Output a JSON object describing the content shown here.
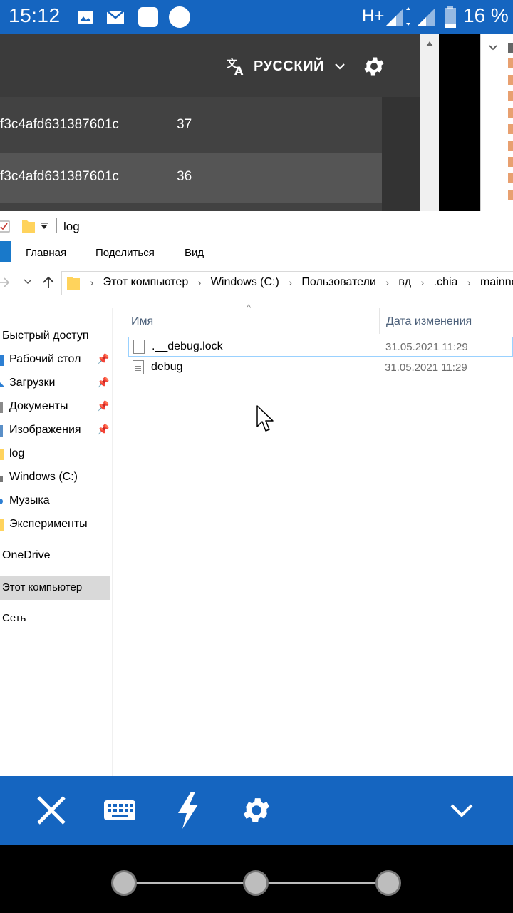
{
  "status_bar": {
    "time": "15:12",
    "network": "H+",
    "battery": "16 %",
    "icons": [
      "image-icon",
      "mail-icon",
      "square-icon",
      "circle-icon",
      "signal-icon",
      "battery-icon"
    ]
  },
  "remote_app": {
    "language_label": "РУССКИЙ",
    "rows": [
      {
        "hash": "f3c4afd631387601c",
        "count": "37"
      },
      {
        "hash": "f3c4afd631387601c",
        "count": "36"
      }
    ]
  },
  "explorer": {
    "window_title": "log",
    "ribbon_tabs": [
      "Главная",
      "Поделиться",
      "Вид"
    ],
    "breadcrumbs": [
      "Этот компьютер",
      "Windows (C:)",
      "Пользователи",
      "вд",
      ".chia",
      "mainnet"
    ],
    "nav_items": [
      {
        "label": "Быстрый доступ",
        "pinned": false
      },
      {
        "label": "Рабочий стол",
        "pinned": true
      },
      {
        "label": "Загрузки",
        "pinned": true
      },
      {
        "label": "Документы",
        "pinned": true
      },
      {
        "label": "Изображения",
        "pinned": true
      },
      {
        "label": "log",
        "pinned": false
      },
      {
        "label": "Windows (C:)",
        "pinned": false
      },
      {
        "label": "Музыка",
        "pinned": false
      },
      {
        "label": "Эксперименты",
        "pinned": false
      },
      {
        "label": "OneDrive",
        "pinned": false
      },
      {
        "label": "Этот компьютер",
        "pinned": false,
        "selected": true
      },
      {
        "label": "Сеть",
        "pinned": false
      }
    ],
    "columns": {
      "name": "Имя",
      "date": "Дата изменения"
    },
    "files": [
      {
        "name": ".__debug.lock",
        "date": "31.05.2021 11:29",
        "selected": true
      },
      {
        "name": "debug",
        "date": "31.05.2021 11:29",
        "selected": false
      }
    ]
  },
  "colors": {
    "android_blue": "#1565c0",
    "dark_header": "#3b3b3b",
    "selection_border": "#99d1ff"
  }
}
